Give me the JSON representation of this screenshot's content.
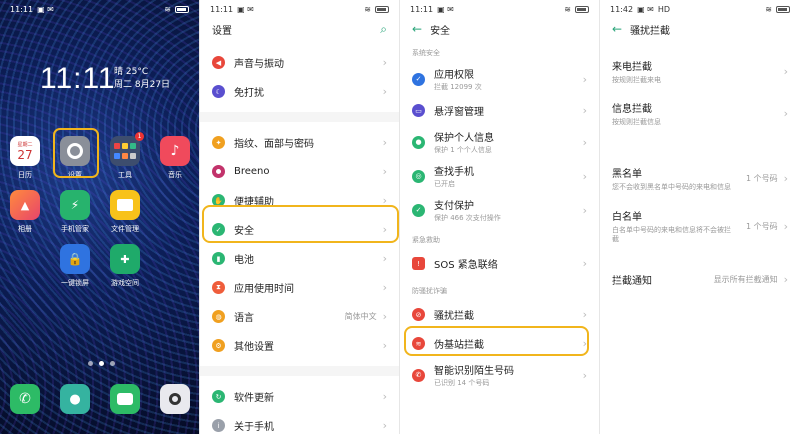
{
  "status": {
    "p1_time": "11:11",
    "p2_time": "11:11",
    "p3_time": "11:11",
    "p4_time": "11:42",
    "hd": "HD",
    "batt": "58"
  },
  "home": {
    "clock": "11:11",
    "weather1": "晴 25°C",
    "weather2": "周二  8月27日",
    "calendar_day": "27",
    "calendar_header": "星期二",
    "tools_badge": "1",
    "apps_row1": [
      "日历",
      "设置",
      "工具",
      "音乐"
    ],
    "apps_row2": [
      "相册",
      "手机管家",
      "文件管理"
    ],
    "apps_row3": [
      "一键锁屏",
      "游戏空间"
    ]
  },
  "settings": {
    "title": "设置",
    "items": [
      "声音与振动",
      "免打扰",
      "指纹、面部与密码",
      "Breeno",
      "便捷辅助",
      "安全",
      "电池",
      "应用使用时间",
      "语言",
      "其他设置",
      "软件更新",
      "关于手机"
    ],
    "language_value": "简体中文"
  },
  "security": {
    "title": "安全",
    "sec1": "系统安全",
    "app_perm": "应用权限",
    "app_perm_sub": "拦截 12099 次",
    "float_mgmt": "悬浮窗管理",
    "privacy": "保护个人信息",
    "privacy_sub": "保护 1 个个人信息",
    "find_phone": "查找手机",
    "find_phone_sub": "已开启",
    "pay": "支付保护",
    "pay_sub": "保护 466 次支付操作",
    "sec2": "紧急救助",
    "sos": "SOS 紧急联络",
    "sec3": "防骚扰诈骗",
    "block": "骚扰拦截",
    "fake_base": "伪基站拦截",
    "smart_id": "智能识别陌生号码",
    "smart_id_sub": "已识别 14 个号码"
  },
  "block": {
    "title": "骚扰拦截",
    "call": "来电拦截",
    "call_sub": "按规则拦截来电",
    "msg": "信息拦截",
    "msg_sub": "按规则拦截信息",
    "black": "黑名单",
    "black_sub": "您不会收到黑名单中号码的来电和信息",
    "black_val": "1 个号码",
    "white": "白名单",
    "white_sub": "白名单中号码的来电和信息将不会被拦截",
    "white_val": "1 个号码",
    "notify": "拦截通知",
    "notify_val": "显示所有拦截通知"
  }
}
